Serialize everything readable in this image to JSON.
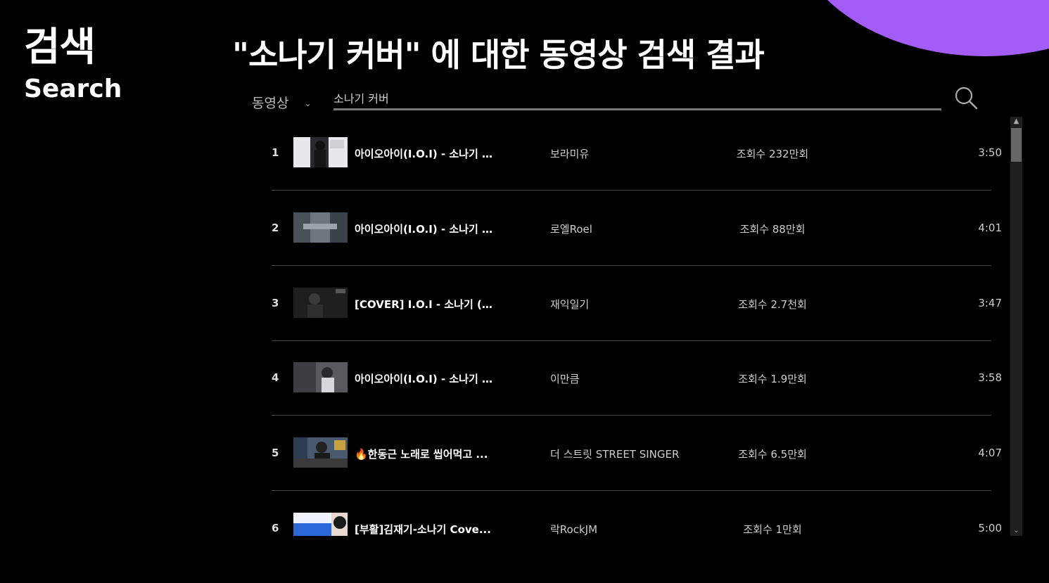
{
  "sidebar": {
    "title_ko": "검색",
    "title_en": "Search"
  },
  "header": {
    "title": "\"소나기 커버\" 에 대한 동영상 검색 결과"
  },
  "search": {
    "type_selected": "동영상",
    "query": "소나기 커버",
    "button_icon": "search-icon"
  },
  "results": [
    {
      "rank": "1",
      "title": "아이오아이(I.O.I) - 소나기 ...",
      "artist": "보라미유",
      "views": "조회수 232만회",
      "duration": "3:50"
    },
    {
      "rank": "2",
      "title": "아이오아이(I.O.I) - 소나기 ...",
      "artist": "로엘Roel",
      "views": "조회수 88만회",
      "duration": "4:01"
    },
    {
      "rank": "3",
      "title": "[COVER] I.O.I - 소나기 (...",
      "artist": "재익일기",
      "views": "조회수 2.7천회",
      "duration": "3:47"
    },
    {
      "rank": "4",
      "title": "아이오아이(I.O.I) - 소나기 ...",
      "artist": "이만큼",
      "views": "조회수 1.9만회",
      "duration": "3:58"
    },
    {
      "rank": "5",
      "title": "🔥한동근 노래로 씹어먹고 ...",
      "artist": "더 스트릿 STREET SINGER",
      "views": "조회수 6.5만회",
      "duration": "4:07"
    },
    {
      "rank": "6",
      "title": "[부활]김재기-소나기 Cove...",
      "artist": "락RockJM",
      "views": "조회수 1만회",
      "duration": "5:00"
    }
  ],
  "colors": {
    "background": "#000000",
    "accent_blob": "#a45cf6",
    "divider": "#444444"
  }
}
